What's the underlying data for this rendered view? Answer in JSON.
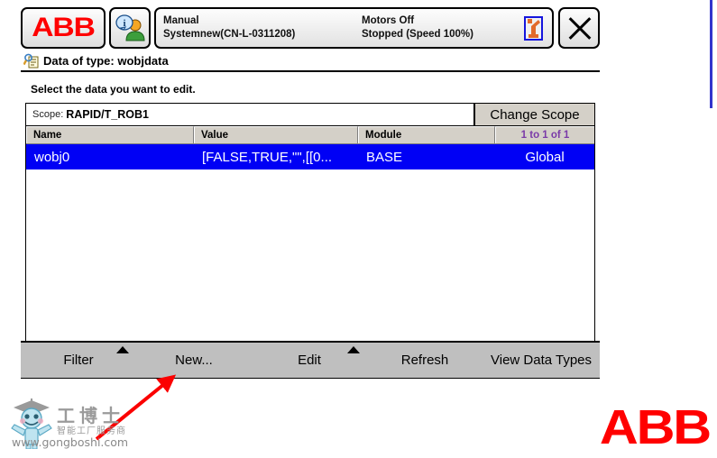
{
  "window": {
    "logo_text": "ABB",
    "title": "Data of type: wobjdata",
    "title_icon": "data-lookup-icon",
    "operator_icon": "operator-info-icon",
    "robot_icon": "robot-arm-icon",
    "close_icon": "close-x-icon"
  },
  "status": {
    "mode": "Manual",
    "system": "Systemnew(CN-L-0311208)",
    "motors": "Motors Off",
    "execution": "Stopped (Speed 100%)"
  },
  "content": {
    "instruction": "Select the data you want to edit.",
    "scope_label": "Scope:",
    "scope_value": "RAPID/T_ROB1",
    "change_scope_label": "Change Scope"
  },
  "table": {
    "columns": [
      "Name",
      "Value",
      "Module",
      ""
    ],
    "range_label": "1 to 1 of 1",
    "rows": [
      {
        "name": "wobj0",
        "value": "[FALSE,TRUE,\"\",[[0...",
        "module": "BASE",
        "scope": "Global",
        "selected": true
      }
    ]
  },
  "toolbar": {
    "filter_label": "Filter",
    "new_label": "New...",
    "edit_label": "Edit",
    "refresh_label": "Refresh",
    "view_data_types_label": "View Data Types"
  },
  "watermark": {
    "cn_name": "工博士",
    "tagline": "智能工厂服务商",
    "url": "www.gongboshi.com"
  },
  "branding": {
    "abb_wordmark": "ABB"
  },
  "colors": {
    "selection_blue": "#0000f5",
    "abb_red": "#ff0000",
    "toolbar_gray": "#bfbfbf",
    "header_gray": "#d4d0c8",
    "count_purple": "#7a3aa8",
    "annotation_red": "#fb0000",
    "edge_blue": "#3333cc"
  }
}
